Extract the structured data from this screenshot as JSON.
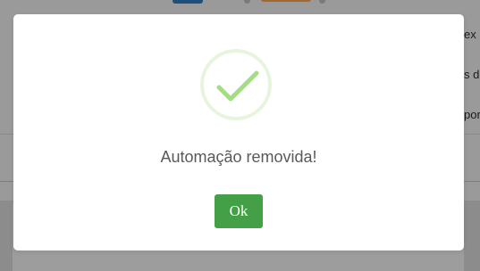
{
  "background": {
    "fragments": [
      "ex",
      "s de",
      "por"
    ]
  },
  "modal": {
    "icon": "success-check-icon",
    "message": "Automação removida!",
    "ok_label": "Ok"
  },
  "colors": {
    "success": "#a5dc86",
    "ok_button": "#43a047",
    "overlay": "#8f8f8f"
  }
}
